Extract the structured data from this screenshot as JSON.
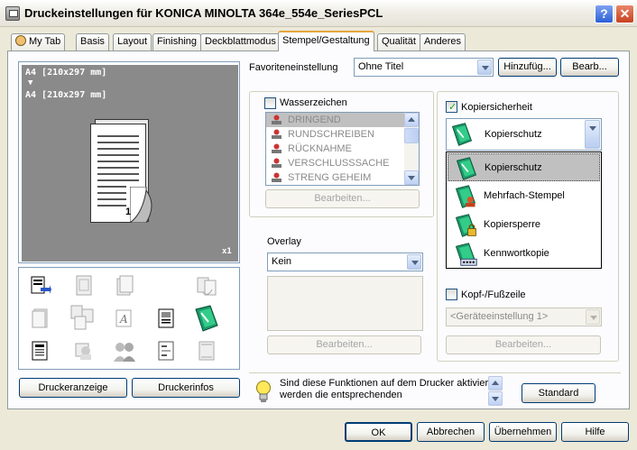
{
  "window": {
    "title": "Druckeinstellungen für KONICA MINOLTA 364e_554e_SeriesPCL",
    "help_btn": "?",
    "close_btn": "✕"
  },
  "tabs": [
    {
      "label": "My Tab"
    },
    {
      "label": "Basis"
    },
    {
      "label": "Layout"
    },
    {
      "label": "Finishing"
    },
    {
      "label": "Deckblattmodus"
    },
    {
      "label": "Stempel/Gestaltung",
      "active": true
    },
    {
      "label": "Qualität"
    },
    {
      "label": "Anderes"
    }
  ],
  "preview": {
    "line1": "A4 [210x297 mm]",
    "arrow": "▼",
    "line2": "A4 [210x297 mm]",
    "page_number": "1",
    "copies": "x1"
  },
  "left_buttons": {
    "printer_view": "Druckeranzeige",
    "printer_info": "Druckerinfos"
  },
  "favorites": {
    "label": "Favoriteneinstellung",
    "value": "Ohne Titel",
    "add_btn": "Hinzufüg...",
    "edit_btn": "Bearb..."
  },
  "watermark": {
    "label": "Wasserzeichen",
    "checked": false,
    "items": [
      "DRINGEND",
      "RUNDSCHREIBEN",
      "RÜCKNAHME",
      "VERSCHLUSSSACHE",
      "STRENG GEHEIM"
    ],
    "selected_index": 0,
    "edit_btn": "Bearbeiten..."
  },
  "overlay": {
    "label": "Overlay",
    "value": "Kein",
    "edit_btn": "Bearbeiten..."
  },
  "copy_security": {
    "label": "Kopiersicherheit",
    "checked": true,
    "value": "Kopierschutz",
    "options": [
      "Kopierschutz",
      "Mehrfach-Stempel",
      "Kopiersperre",
      "Kennwortkopie"
    ],
    "selected_index": 0
  },
  "header_footer": {
    "label": "Kopf-/Fußzeile",
    "checked": false,
    "value": "<Geräteeinstellung 1>",
    "edit_btn": "Bearbeiten..."
  },
  "info": {
    "line1": "Sind diese Funktionen auf dem Drucker aktiviert,",
    "line2": "werden die entsprechenden",
    "standard_btn": "Standard"
  },
  "footer": {
    "ok": "OK",
    "cancel": "Abbrechen",
    "apply": "Übernehmen",
    "help": "Hilfe"
  },
  "colors": {
    "accent_tab": "#e8a33d",
    "preview_bg": "#8a8a8a",
    "selection_gray": "#c0c0c0",
    "xp_border": "#003c74"
  }
}
